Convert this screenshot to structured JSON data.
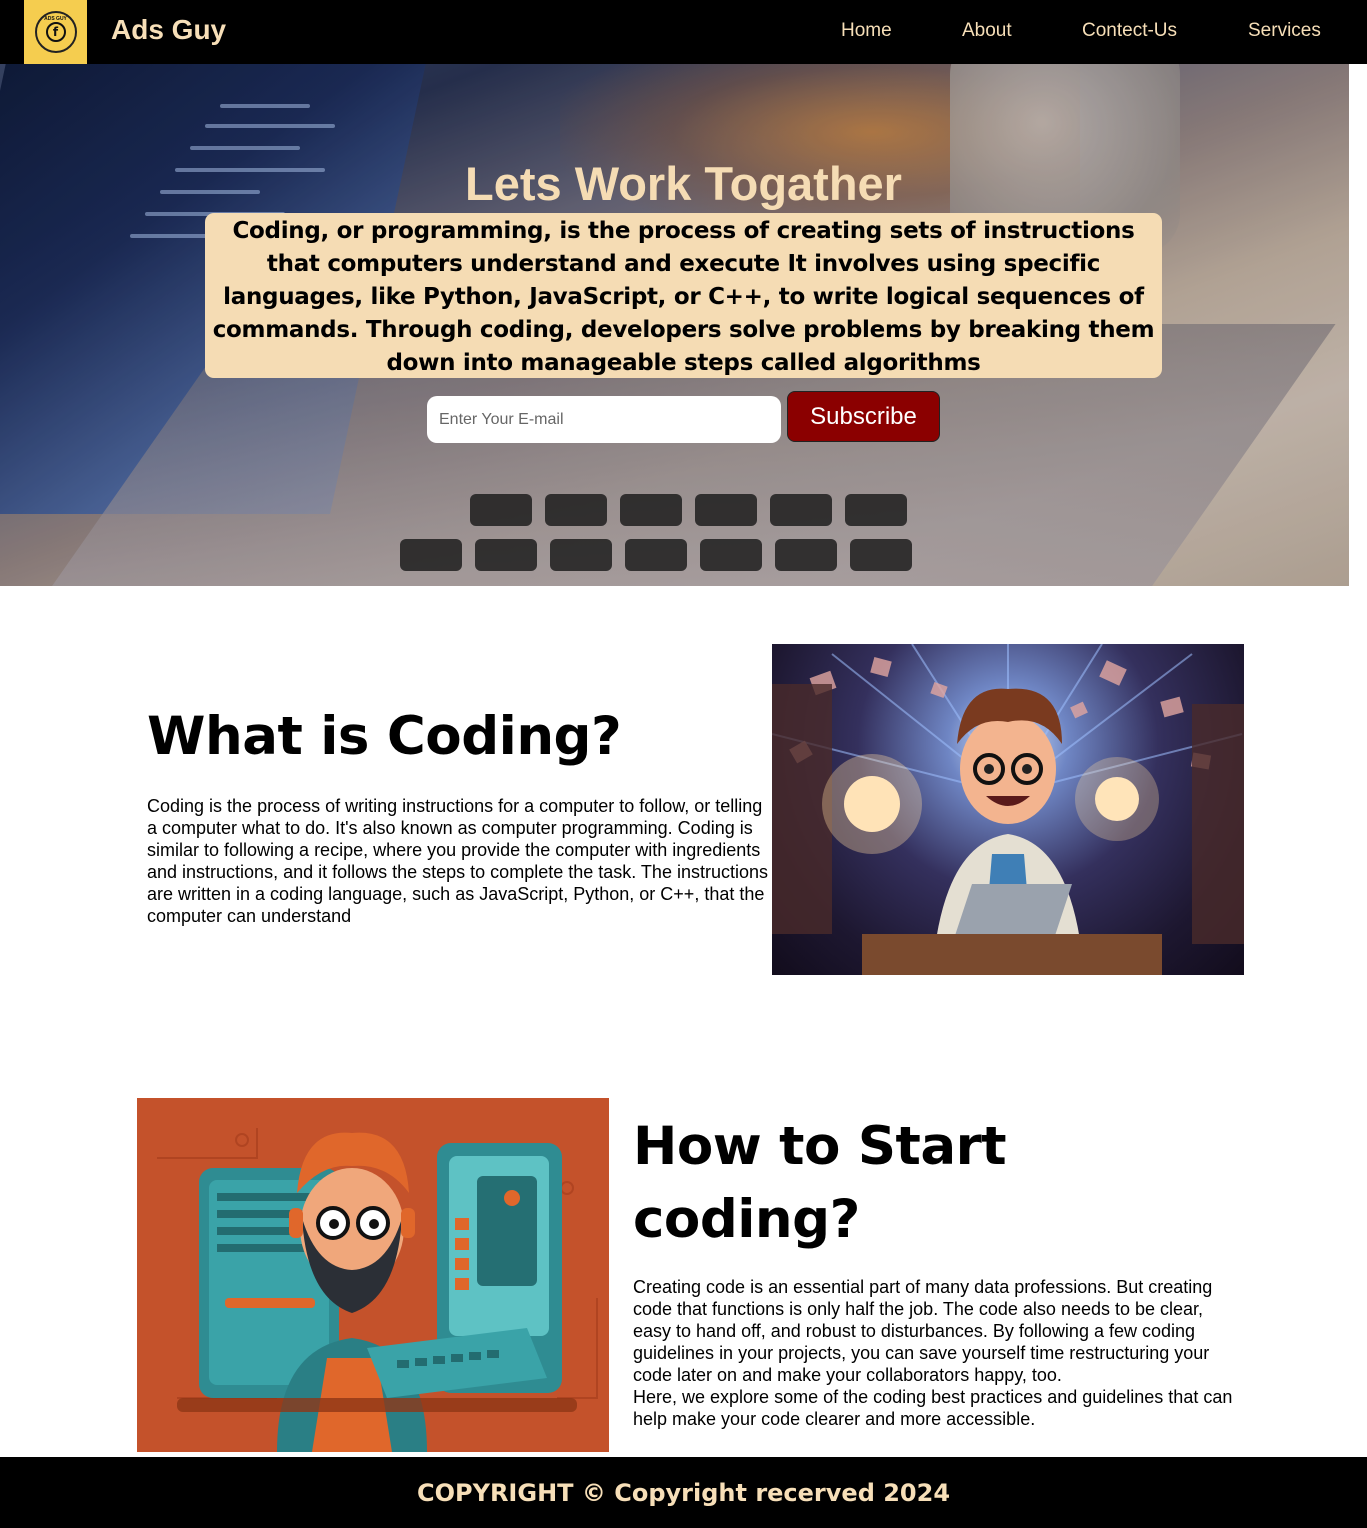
{
  "header": {
    "logo_text": "ADS GUY",
    "logo_icon": "facebook-icon",
    "brand": "Ads Guy",
    "nav": [
      {
        "label": "Home"
      },
      {
        "label": "About"
      },
      {
        "label": "Contect-Us"
      },
      {
        "label": "Services"
      }
    ]
  },
  "hero": {
    "title": "Lets Work Togather",
    "description": "Coding, or programming, is the process of creating sets of instructions that computers understand and execute It involves using specific languages, like Python, JavaScript, or C++, to write logical sequences of commands. Through coding, developers solve problems by breaking them down into manageable steps called algorithms",
    "email_placeholder": "Enter Your E-mail",
    "email_value": "",
    "subscribe_label": "Subscribe"
  },
  "section1": {
    "title": "What is Coding?",
    "text": "Coding is the process of writing instructions for a computer to follow, or telling a computer what to do. It's also known as computer programming. Coding is similar to following a recipe, where you provide the computer with ingredients and instructions, and it follows the steps to complete the task. The instructions are written in a coding language, such as JavaScript, Python, or C++, that the computer can understand"
  },
  "section2": {
    "title": "How to Start coding?",
    "paragraph1": "Creating code is an essential part of many data professions. But creating code that functions is only half the job. The code also needs to be clear, easy to hand off, and robust to disturbances. By following a few coding guidelines in your projects, you can save yourself time restructuring your code later on and make your collaborators happy, too.",
    "paragraph2": "Here, we explore some of the coding best practices and guidelines that can help make your code clearer and more accessible."
  },
  "footer": {
    "text": "COPYRIGHT © Copyright recerved 2024"
  },
  "colors": {
    "nav_bg": "#000000",
    "logo_bg": "#f5cd4f",
    "accent_text": "#f7dfb8",
    "hero_box": "#f5dcb4",
    "subscribe_bg": "#8b0000"
  }
}
